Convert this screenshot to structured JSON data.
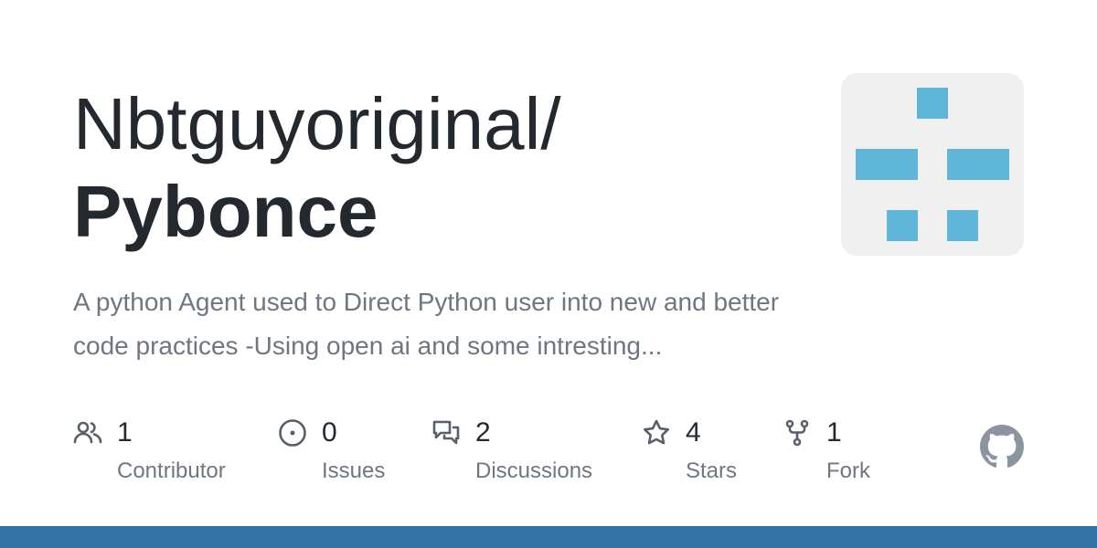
{
  "repo": {
    "owner": "Nbtguyoriginal/",
    "name": "Pybonce",
    "description": "A python Agent used to Direct Python user into new and better code practices -Using open ai and some intresting..."
  },
  "stats": [
    {
      "icon": "people-icon",
      "count": "1",
      "label": "Contributor"
    },
    {
      "icon": "issue-icon",
      "count": "0",
      "label": "Issues"
    },
    {
      "icon": "discussions-icon",
      "count": "2",
      "label": "Discussions"
    },
    {
      "icon": "star-icon",
      "count": "4",
      "label": "Stars"
    },
    {
      "icon": "fork-icon",
      "count": "1",
      "label": "Fork"
    }
  ],
  "colors": {
    "avatar_bg": "#f0f0f0",
    "avatar_block": "#60b6d8",
    "bottom_bar": "#3572a5",
    "icon": "#57606a",
    "logo": "#8c959f"
  },
  "logo": "github-logo-icon"
}
